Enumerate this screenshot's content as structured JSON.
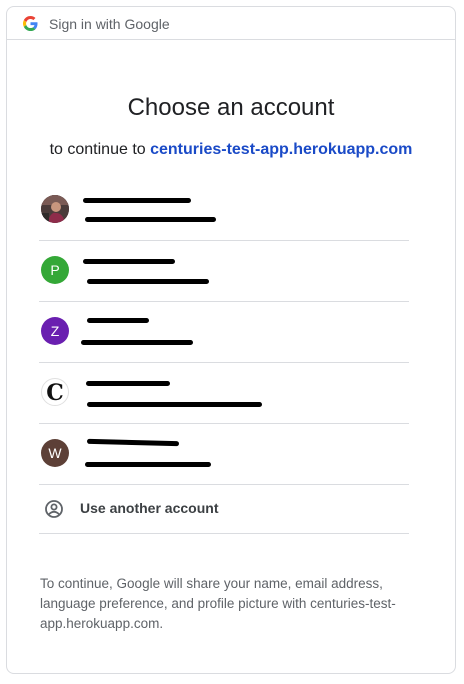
{
  "header": {
    "logo_icon": "google-g-icon",
    "title": "Sign in with Google"
  },
  "main": {
    "heading": "Choose an account",
    "continue_prefix": "to continue to ",
    "app_domain": "centuries-test-app.herokuapp.com"
  },
  "accounts": [
    {
      "avatar_type": "photo",
      "avatar_letter": "",
      "avatar_color": "#5b3a4a",
      "name": "",
      "email": ""
    },
    {
      "avatar_type": "letter",
      "avatar_letter": "P",
      "avatar_color": "#34a837",
      "name": "",
      "email": ""
    },
    {
      "avatar_type": "letter",
      "avatar_letter": "Z",
      "avatar_color": "#6a1fb0",
      "name": "",
      "email": ""
    },
    {
      "avatar_type": "logo",
      "avatar_letter": "C",
      "avatar_color": "#ffffff",
      "name": "",
      "email": ""
    },
    {
      "avatar_type": "letter",
      "avatar_letter": "W",
      "avatar_color": "#5d4037",
      "name": "",
      "email": ""
    }
  ],
  "use_another": {
    "icon": "account-circle-icon",
    "label": "Use another account"
  },
  "footer": {
    "text": "To continue, Google will share your name, email address, language preference, and profile picture with centuries-test-app.herokuapp.com."
  }
}
